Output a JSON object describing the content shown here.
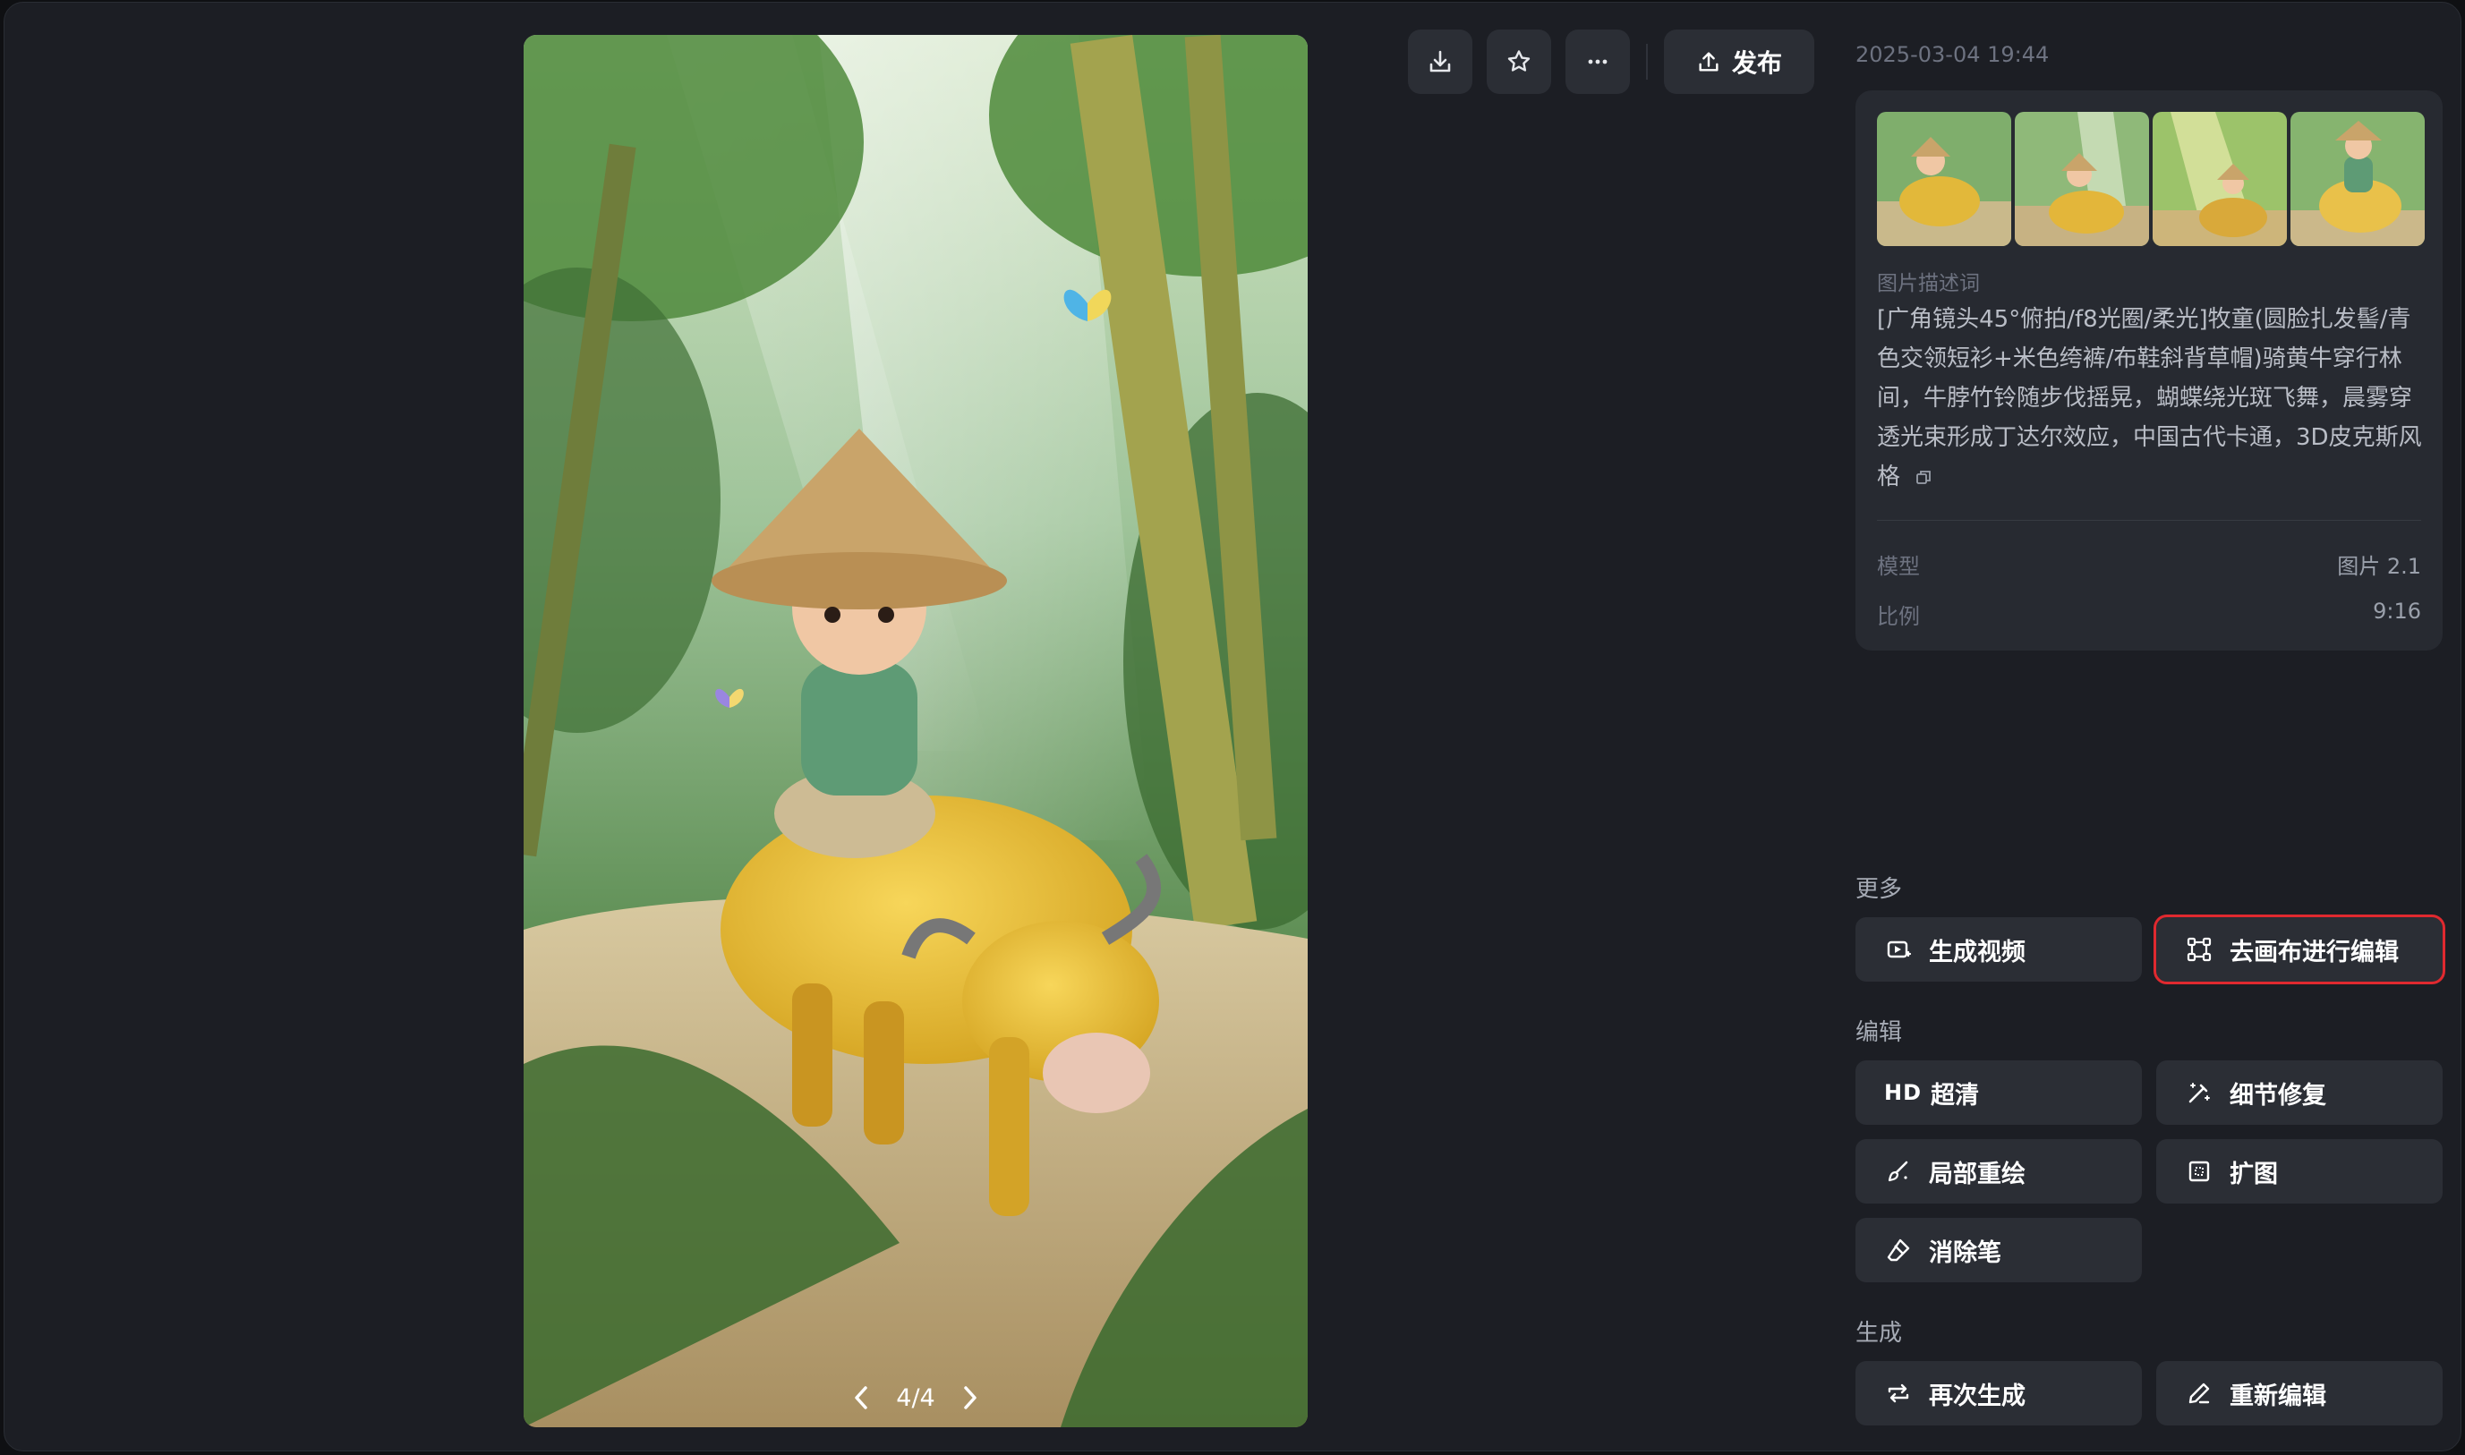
{
  "timestamp": "2025-03-04 19:44",
  "image_pager": {
    "label": "4/4"
  },
  "toolbar": {
    "download_icon": "download-icon",
    "favorite_icon": "star-icon",
    "more_icon": "more-icon",
    "publish_label": "发布"
  },
  "info": {
    "description_label": "图片描述词",
    "description": "[广角镜头45°俯拍/f8光圈/柔光]牧童(圆脸扎发髻/青色交领短衫+米色绔裤/布鞋斜背草帽)骑黄牛穿行林间，牛脖竹铃随步伐摇晃，蝴蝶绕光斑飞舞，晨雾穿透光束形成丁达尔效应，中国古代卡通，3D皮克斯风格",
    "model_label": "模型",
    "model_value": "图片 2.1",
    "ratio_label": "比例",
    "ratio_value": "9:16"
  },
  "sections": {
    "more": {
      "title": "更多",
      "generate_video": "生成视频",
      "canvas_edit": "去画布进行编辑"
    },
    "edit": {
      "title": "编辑",
      "hd_badge": "HD",
      "upscale": "超清",
      "detail_fix": "细节修复",
      "inpaint": "局部重绘",
      "expand": "扩图",
      "eraser": "消除笔"
    },
    "generate": {
      "title": "生成",
      "regenerate": "再次生成",
      "reedit": "重新编辑"
    }
  },
  "colors": {
    "background": "#1c1e24",
    "panel": "#272a31",
    "button": "#2b2e35",
    "highlight_border": "#e0292f"
  }
}
